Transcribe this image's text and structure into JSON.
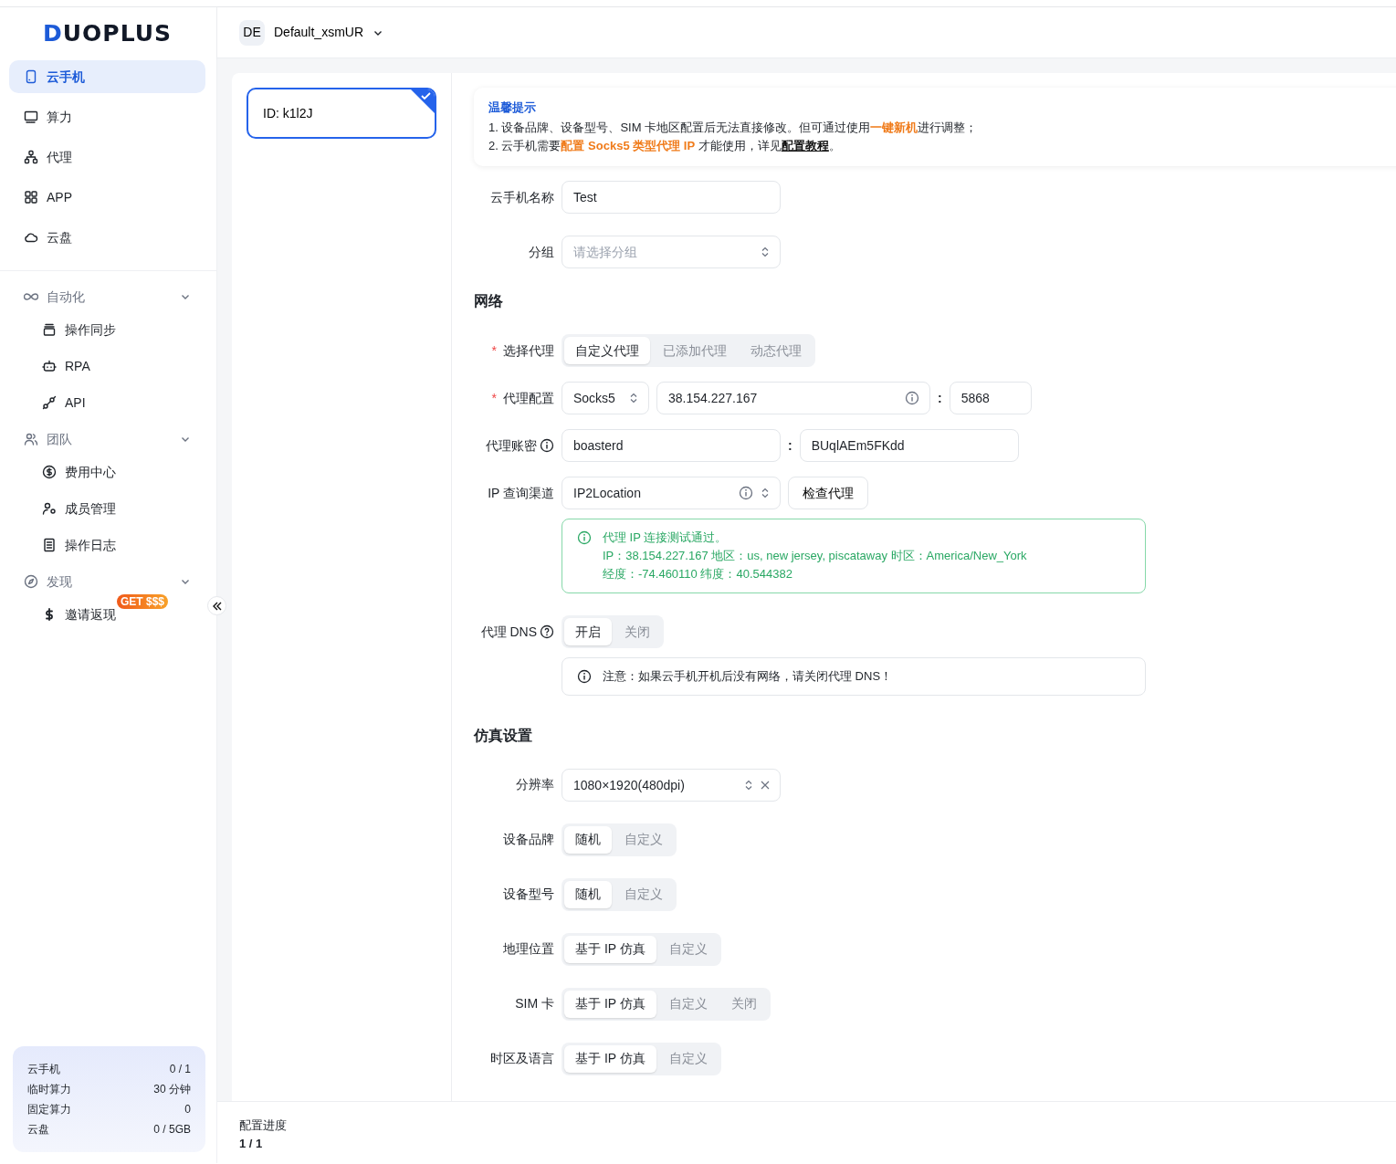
{
  "logo": {
    "text": "DUOPLUS"
  },
  "workspace": {
    "badge": "DE",
    "name": "Default_xsmUR"
  },
  "sidebar": {
    "items": [
      {
        "label": "云手机",
        "selected": true
      },
      {
        "label": "算力",
        "selected": false
      },
      {
        "label": "代理",
        "selected": false
      },
      {
        "label": "APP",
        "selected": false
      },
      {
        "label": "云盘",
        "selected": false
      }
    ],
    "groups": [
      {
        "label": "自动化",
        "expanded": true,
        "children": [
          {
            "label": "操作同步"
          },
          {
            "label": "RPA"
          },
          {
            "label": "API"
          }
        ]
      },
      {
        "label": "团队",
        "expanded": true,
        "children": [
          {
            "label": "费用中心"
          },
          {
            "label": "成员管理"
          },
          {
            "label": "操作日志"
          }
        ]
      },
      {
        "label": "发现",
        "expanded": true,
        "children": [
          {
            "label": "邀请返现",
            "badge": "GET $$$"
          }
        ]
      }
    ]
  },
  "usage": [
    {
      "label": "云手机",
      "value": "0 / 1"
    },
    {
      "label": "临时算力",
      "value": "30 分钟"
    },
    {
      "label": "固定算力",
      "value": "0"
    },
    {
      "label": "云盘",
      "value": "0 / 5GB"
    }
  ],
  "devices": [
    {
      "label": "ID: k1l2J",
      "selected": true
    }
  ],
  "notice": {
    "title": "温馨提示",
    "lines": [
      [
        {
          "kind": "plain",
          "text": "1. 设备品牌、设备型号、SIM 卡地区配置后无法直接修改。但可通过使用"
        },
        {
          "kind": "highlight",
          "text": "一键新机"
        },
        {
          "kind": "plain",
          "text": "进行调整；"
        }
      ],
      [
        {
          "kind": "plain",
          "text": "2. 云手机需要"
        },
        {
          "kind": "highlight",
          "text": "配置 Socks5 类型代理 IP"
        },
        {
          "kind": "plain",
          "text": " 才能使用，详见"
        },
        {
          "kind": "link",
          "text": "配置教程"
        },
        {
          "kind": "plain",
          "text": "。"
        }
      ]
    ]
  },
  "phone_name": {
    "label": "云手机名称",
    "value": "Test"
  },
  "group": {
    "label": "分组",
    "placeholder": "请选择分组"
  },
  "network": {
    "title": "网络",
    "proxy_type": {
      "label": "选择代理",
      "required_mark": "*",
      "options": [
        {
          "label": "自定义代理",
          "selected": true
        },
        {
          "label": "已添加代理",
          "selected": false
        },
        {
          "label": "动态代理",
          "selected": false
        }
      ]
    },
    "proxy_config": {
      "label": "代理配置",
      "required_mark": "*",
      "protocol": "Socks5",
      "host": "38.154.227.167",
      "separator": ":",
      "port": "5868"
    },
    "proxy_account": {
      "label": "代理账密",
      "username": "boasterd",
      "separator": ":",
      "password": "BUqlAEm5FKdd"
    },
    "ip_channel": {
      "label": "IP 查询渠道",
      "value": "IP2Location",
      "button": "检查代理"
    },
    "check_result": {
      "lines": [
        "代理 IP 连接测试通过。",
        "IP：38.154.227.167  地区：us, new jersey, piscataway  时区：America/New_York",
        "经度：-74.460110  纬度：40.544382"
      ]
    },
    "proxy_dns": {
      "label": "代理 DNS",
      "options": [
        {
          "label": "开启",
          "selected": true
        },
        {
          "label": "关闭",
          "selected": false
        }
      ]
    },
    "dns_note": "注意：如果云手机开机后没有网络，请关闭代理 DNS！"
  },
  "emulation": {
    "title": "仿真设置",
    "resolution": {
      "label": "分辨率",
      "value": "1080×1920(480dpi)"
    },
    "rows": [
      {
        "label": "设备品牌",
        "options": [
          {
            "label": "随机",
            "selected": true
          },
          {
            "label": "自定义",
            "selected": false
          }
        ]
      },
      {
        "label": "设备型号",
        "options": [
          {
            "label": "随机",
            "selected": true
          },
          {
            "label": "自定义",
            "selected": false
          }
        ]
      },
      {
        "label": "地理位置",
        "options": [
          {
            "label": "基于 IP 仿真",
            "selected": true
          },
          {
            "label": "自定义",
            "selected": false
          }
        ]
      },
      {
        "label": "SIM 卡",
        "options": [
          {
            "label": "基于 IP 仿真",
            "selected": true
          },
          {
            "label": "自定义",
            "selected": false
          },
          {
            "label": "关闭",
            "selected": false
          }
        ]
      },
      {
        "label": "时区及语言",
        "options": [
          {
            "label": "基于 IP 仿真",
            "selected": true
          },
          {
            "label": "自定义",
            "selected": false
          }
        ]
      }
    ]
  },
  "footer": {
    "label": "配置进度",
    "value": "1 / 1"
  }
}
